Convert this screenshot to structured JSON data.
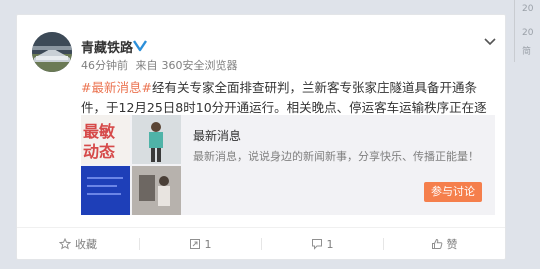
{
  "post": {
    "username": "青藏铁路",
    "time": "46分钟前",
    "source_prefix": "来自",
    "source": "360安全浏览器",
    "hashtag": "#最新消息#",
    "body": "经有关专家全面排查研判，兰新客专张家庄隧道具备开通条件，于12月25日8时10分开通运行。相关晚点、停运客车运输秩序正在逐步恢复中。"
  },
  "link_card": {
    "thumb_text_1": "最敏",
    "thumb_text_2": "动态",
    "title": "最新消息",
    "description": "最新消息，说说身边的新闻新事，分享快乐、传播正能量！",
    "button": "参与讨论"
  },
  "footer": {
    "collect": "收藏",
    "repost": "1",
    "comment": "1",
    "like": "赞"
  },
  "sidebar": {
    "items": [
      "20",
      "20",
      "简"
    ]
  },
  "colors": {
    "hashtag": "#eb7350",
    "button": "#f57f4c",
    "verified": "#2b8fd9"
  }
}
